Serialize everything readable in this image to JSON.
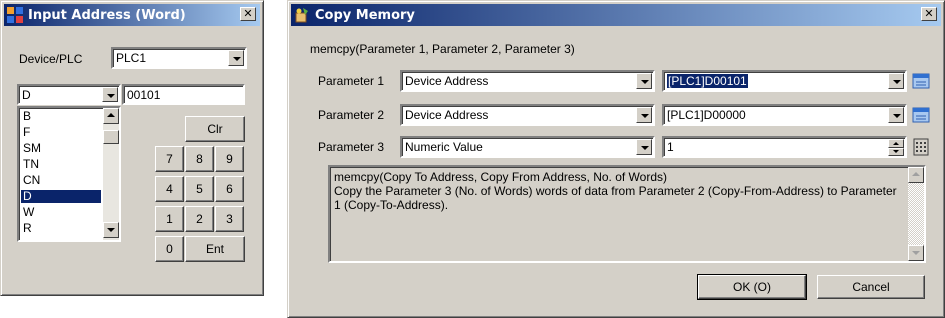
{
  "input_address_dialog": {
    "title": "Input Address (Word)",
    "device_plc_label": "Device/PLC",
    "device_plc_value": "PLC1",
    "device_type_value": "D",
    "address_value": "00101",
    "device_list": [
      "B",
      "F",
      "SM",
      "TN",
      "CN",
      "D",
      "W",
      "R"
    ],
    "selected_device": "D",
    "keypad": {
      "clear": "Clr",
      "keys": [
        "7",
        "8",
        "9",
        "4",
        "5",
        "6",
        "1",
        "2",
        "3",
        "0"
      ],
      "enter": "Ent"
    }
  },
  "copy_memory_dialog": {
    "title": "Copy Memory",
    "signature": "memcpy(Parameter 1, Parameter 2, Parameter 3)",
    "parameters": [
      {
        "label": "Parameter 1",
        "type": "Device Address",
        "value": "[PLC1]D00101"
      },
      {
        "label": "Parameter 2",
        "type": "Device Address",
        "value": "[PLC1]D00000"
      },
      {
        "label": "Parameter 3",
        "type": "Numeric Value",
        "value": "1"
      }
    ],
    "description": "memcpy(Copy To Address, Copy From Address, No. of Words)\nCopy the Parameter 3 (No. of Words) words of data from Parameter 2 (Copy-From-Address) to Parameter 1 (Copy-To-Address).",
    "ok_label": "OK (O)",
    "cancel_label": "Cancel"
  }
}
